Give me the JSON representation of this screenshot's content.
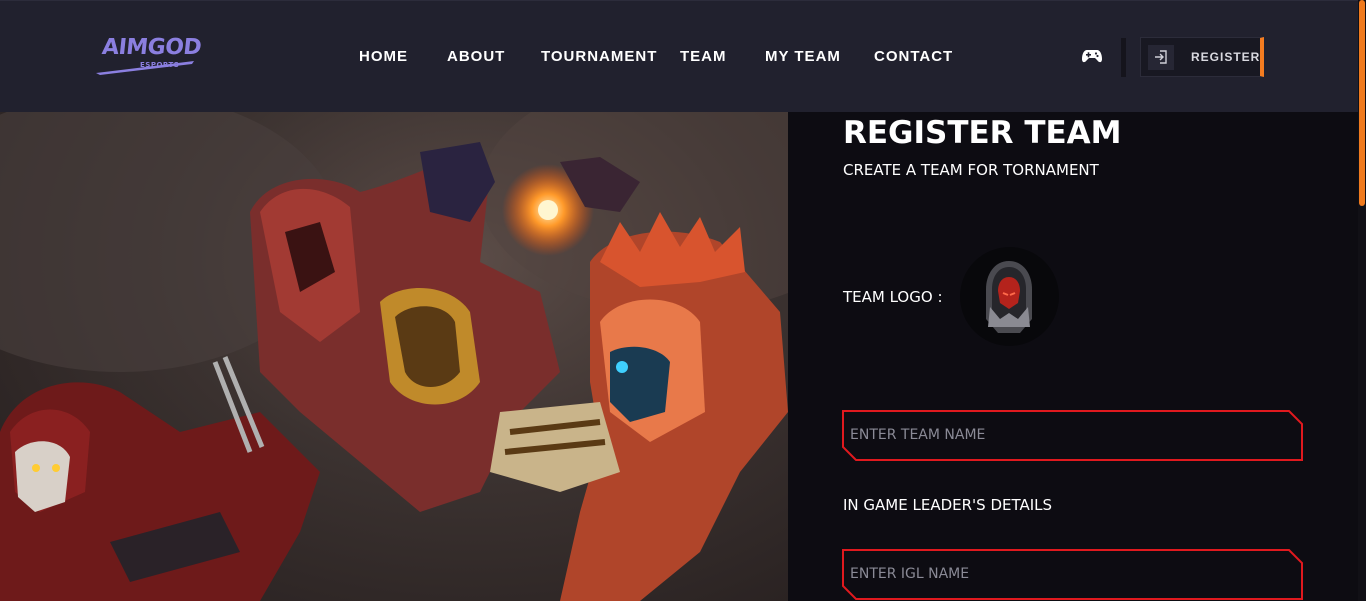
{
  "brand": {
    "name": "AIMGOD",
    "tagline": "ESPORTS",
    "color": "#8b7fe0"
  },
  "nav": {
    "items": [
      {
        "label": "HOME"
      },
      {
        "label": "ABOUT"
      },
      {
        "label": "TOURNAMENT"
      },
      {
        "label": "TEAM"
      },
      {
        "label": "MY TEAM"
      },
      {
        "label": "CONTACT"
      }
    ]
  },
  "header_actions": {
    "game_icon": "gamepad-icon",
    "register_icon": "login-icon",
    "register_label": "REGISTER",
    "accent": "#f47c20"
  },
  "hero": {
    "image": "esports-characters-artwork"
  },
  "form": {
    "title": "REGISTER TEAM",
    "subtitle": "CREATE A TEAM FOR TORNAMENT",
    "logo_label": "TEAM LOGO :",
    "team_name_placeholder": "ENTER TEAM NAME",
    "igl_section_label": "IN GAME LEADER'S DETAILS",
    "igl_name_placeholder": "ENTER IGL NAME",
    "field_border_color": "#e0191e"
  }
}
